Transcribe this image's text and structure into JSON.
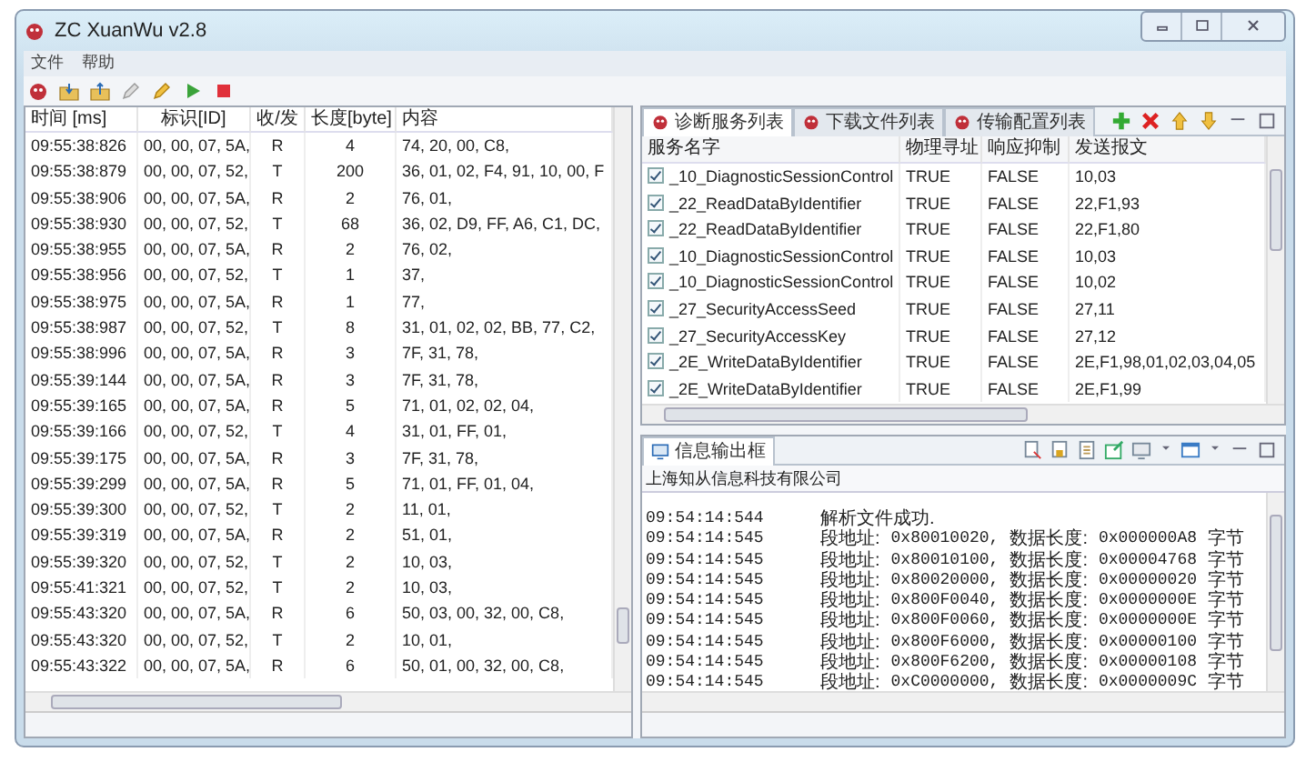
{
  "window": {
    "title": "ZC XuanWu v2.8"
  },
  "menu": [
    "文件",
    "帮助"
  ],
  "message_table": {
    "columns": [
      "时间 [ms]",
      "标识[ID]",
      "收/发",
      "长度[byte]",
      "内容"
    ],
    "rows": [
      [
        "09:55:38:826",
        "00, 00, 07, 5A,",
        "R",
        "4",
        "74, 20, 00, C8,"
      ],
      [
        "09:55:38:879",
        "00, 00, 07, 52,",
        "T",
        "200",
        "36, 01, 02, F4, 91, 10, 00, F"
      ],
      [
        "09:55:38:906",
        "00, 00, 07, 5A,",
        "R",
        "2",
        "76, 01,"
      ],
      [
        "09:55:38:930",
        "00, 00, 07, 52,",
        "T",
        "68",
        "36, 02, D9, FF, A6, C1, DC,"
      ],
      [
        "09:55:38:955",
        "00, 00, 07, 5A,",
        "R",
        "2",
        "76, 02,"
      ],
      [
        "09:55:38:956",
        "00, 00, 07, 52,",
        "T",
        "1",
        "37,"
      ],
      [
        "09:55:38:975",
        "00, 00, 07, 5A,",
        "R",
        "1",
        "77,"
      ],
      [
        "09:55:38:987",
        "00, 00, 07, 52,",
        "T",
        "8",
        "31, 01, 02, 02, BB, 77, C2,"
      ],
      [
        "09:55:38:996",
        "00, 00, 07, 5A,",
        "R",
        "3",
        "7F, 31, 78,"
      ],
      [
        "09:55:39:144",
        "00, 00, 07, 5A,",
        "R",
        "3",
        "7F, 31, 78,"
      ],
      [
        "09:55:39:165",
        "00, 00, 07, 5A,",
        "R",
        "5",
        "71, 01, 02, 02, 04,"
      ],
      [
        "09:55:39:166",
        "00, 00, 07, 52,",
        "T",
        "4",
        "31, 01, FF, 01,"
      ],
      [
        "09:55:39:175",
        "00, 00, 07, 5A,",
        "R",
        "3",
        "7F, 31, 78,"
      ],
      [
        "09:55:39:299",
        "00, 00, 07, 5A,",
        "R",
        "5",
        "71, 01, FF, 01, 04,"
      ],
      [
        "09:55:39:300",
        "00, 00, 07, 52,",
        "T",
        "2",
        "11, 01,"
      ],
      [
        "09:55:39:319",
        "00, 00, 07, 5A,",
        "R",
        "2",
        "51, 01,"
      ],
      [
        "09:55:39:320",
        "00, 00, 07, 52,",
        "T",
        "2",
        "10, 03,"
      ],
      [
        "09:55:41:321",
        "00, 00, 07, 52,",
        "T",
        "2",
        "10, 03,"
      ],
      [
        "09:55:43:320",
        "00, 00, 07, 5A,",
        "R",
        "6",
        "50, 03, 00, 32, 00, C8,"
      ],
      [
        "09:55:43:320",
        "00, 00, 07, 52,",
        "T",
        "2",
        "10, 01,"
      ],
      [
        "09:55:43:322",
        "00, 00, 07, 5A,",
        "R",
        "6",
        "50, 01, 00, 32, 00, C8,"
      ]
    ]
  },
  "service_tabs": [
    {
      "label": "诊断服务列表",
      "selected": true
    },
    {
      "label": "下载文件列表",
      "selected": false
    },
    {
      "label": "传输配置列表",
      "selected": false
    }
  ],
  "service_table": {
    "columns": [
      "服务名字",
      "物理寻址",
      "响应抑制",
      "发送报文"
    ],
    "rows": [
      {
        "name": "_10_DiagnosticSessionControl",
        "checked": true,
        "physical": "TRUE",
        "suppress": "FALSE",
        "message": "10,03"
      },
      {
        "name": "_22_ReadDataByIdentifier",
        "checked": true,
        "physical": "TRUE",
        "suppress": "FALSE",
        "message": "22,F1,93"
      },
      {
        "name": "_22_ReadDataByIdentifier",
        "checked": true,
        "physical": "TRUE",
        "suppress": "FALSE",
        "message": "22,F1,80"
      },
      {
        "name": "_10_DiagnosticSessionControl",
        "checked": true,
        "physical": "TRUE",
        "suppress": "FALSE",
        "message": "10,03"
      },
      {
        "name": "_10_DiagnosticSessionControl",
        "checked": true,
        "physical": "TRUE",
        "suppress": "FALSE",
        "message": "10,02"
      },
      {
        "name": "_27_SecurityAccessSeed",
        "checked": true,
        "physical": "TRUE",
        "suppress": "FALSE",
        "message": "27,11"
      },
      {
        "name": "_27_SecurityAccessKey",
        "checked": true,
        "physical": "TRUE",
        "suppress": "FALSE",
        "message": "27,12"
      },
      {
        "name": "_2E_WriteDataByIdentifier",
        "checked": true,
        "physical": "TRUE",
        "suppress": "FALSE",
        "message": "2E,F1,98,01,02,03,04,05"
      },
      {
        "name": "_2E_WriteDataByIdentifier",
        "checked": true,
        "physical": "TRUE",
        "suppress": "FALSE",
        "message": "2E,F1,99"
      }
    ]
  },
  "output": {
    "tab": "信息输出框",
    "company": "上海知从信息科技有限公司",
    "lines": [
      {
        "time": "09:54:14:544",
        "parts": [
          "解析文件成功."
        ]
      },
      {
        "time": "09:54:14:545",
        "parts": [
          "段地址:",
          "0x80010020,",
          "数据长度:",
          "0x000000A8",
          "字节"
        ]
      },
      {
        "time": "09:54:14:545",
        "parts": [
          "段地址:",
          "0x80010100,",
          "数据长度:",
          "0x00004768",
          "字节"
        ]
      },
      {
        "time": "09:54:14:545",
        "parts": [
          "段地址:",
          "0x80020000,",
          "数据长度:",
          "0x00000020",
          "字节"
        ]
      },
      {
        "time": "09:54:14:545",
        "parts": [
          "段地址:",
          "0x800F0040,",
          "数据长度:",
          "0x0000000E",
          "字节"
        ]
      },
      {
        "time": "09:54:14:545",
        "parts": [
          "段地址:",
          "0x800F0060,",
          "数据长度:",
          "0x0000000E",
          "字节"
        ]
      },
      {
        "time": "09:54:14:545",
        "parts": [
          "段地址:",
          "0x800F6000,",
          "数据长度:",
          "0x00000100",
          "字节"
        ]
      },
      {
        "time": "09:54:14:545",
        "parts": [
          "段地址:",
          "0x800F6200,",
          "数据长度:",
          "0x00000108",
          "字节"
        ]
      },
      {
        "time": "09:54:14:545",
        "parts": [
          "段地址:",
          "0xC0000000,",
          "数据长度:",
          "0x0000009C",
          "字节"
        ]
      }
    ]
  }
}
